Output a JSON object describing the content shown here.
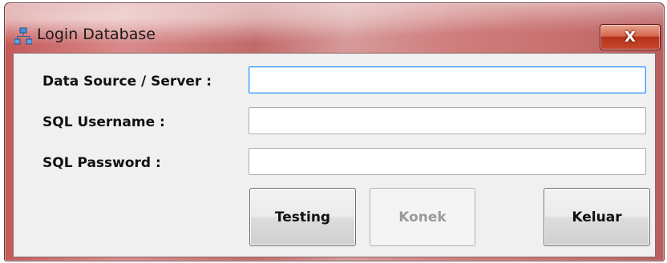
{
  "window": {
    "title": "Login Database",
    "close_label": "X"
  },
  "form": {
    "data_source_label": "Data Source / Server :",
    "data_source_value": "",
    "username_label": "SQL Username :",
    "username_value": "",
    "password_label": "SQL Password :",
    "password_value": ""
  },
  "buttons": {
    "testing_label": "Testing",
    "konek_label": "Konek",
    "keluar_label": "Keluar"
  },
  "state": {
    "focused_field": "data_source",
    "konek_enabled": false
  },
  "icons": {
    "app_icon": "network-icon",
    "close_icon": "close-icon"
  }
}
